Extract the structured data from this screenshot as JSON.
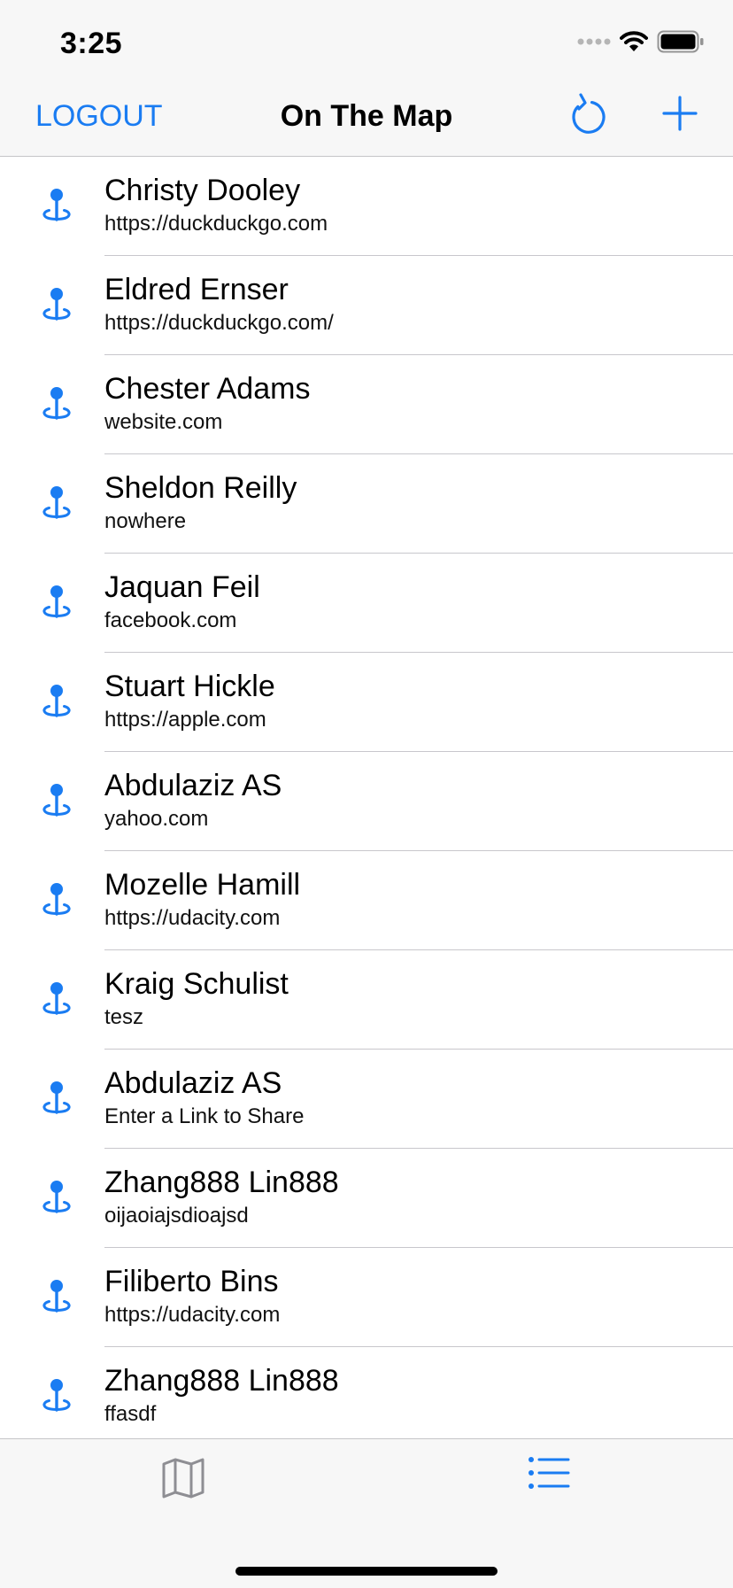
{
  "status_bar": {
    "time": "3:25",
    "icons": [
      "cellular-signal-icon",
      "wifi-icon",
      "battery-icon"
    ]
  },
  "nav": {
    "logout_label": "LOGOUT",
    "title": "On The Map",
    "refresh_icon": "refresh-icon",
    "add_icon": "plus-icon"
  },
  "colors": {
    "accent": "#1a7cf2",
    "bar_background": "#f7f7f7",
    "separator": "#c8c7cc",
    "inactive_tab": "#8e8e93"
  },
  "students": [
    {
      "name": "Christy Dooley",
      "link": "https://duckduckgo.com"
    },
    {
      "name": "Eldred Ernser",
      "link": "https://duckduckgo.com/"
    },
    {
      "name": "Chester Adams",
      "link": "website.com"
    },
    {
      "name": "Sheldon Reilly",
      "link": "nowhere"
    },
    {
      "name": "Jaquan Feil",
      "link": "facebook.com"
    },
    {
      "name": "Stuart Hickle",
      "link": "https://apple.com"
    },
    {
      "name": "Abdulaziz AS",
      "link": "yahoo.com"
    },
    {
      "name": "Mozelle Hamill",
      "link": "https://udacity.com"
    },
    {
      "name": "Kraig Schulist",
      "link": "tesz"
    },
    {
      "name": "Abdulaziz AS",
      "link": "Enter a Link to Share"
    },
    {
      "name": "Zhang888 Lin888",
      "link": "oijaoiajsdioajsd"
    },
    {
      "name": "Filiberto Bins",
      "link": "https://udacity.com"
    },
    {
      "name": "Zhang888 Lin888",
      "link": "ffasdf"
    }
  ],
  "tabs": [
    {
      "icon": "map-icon",
      "selected": false
    },
    {
      "icon": "list-icon",
      "selected": true
    }
  ]
}
